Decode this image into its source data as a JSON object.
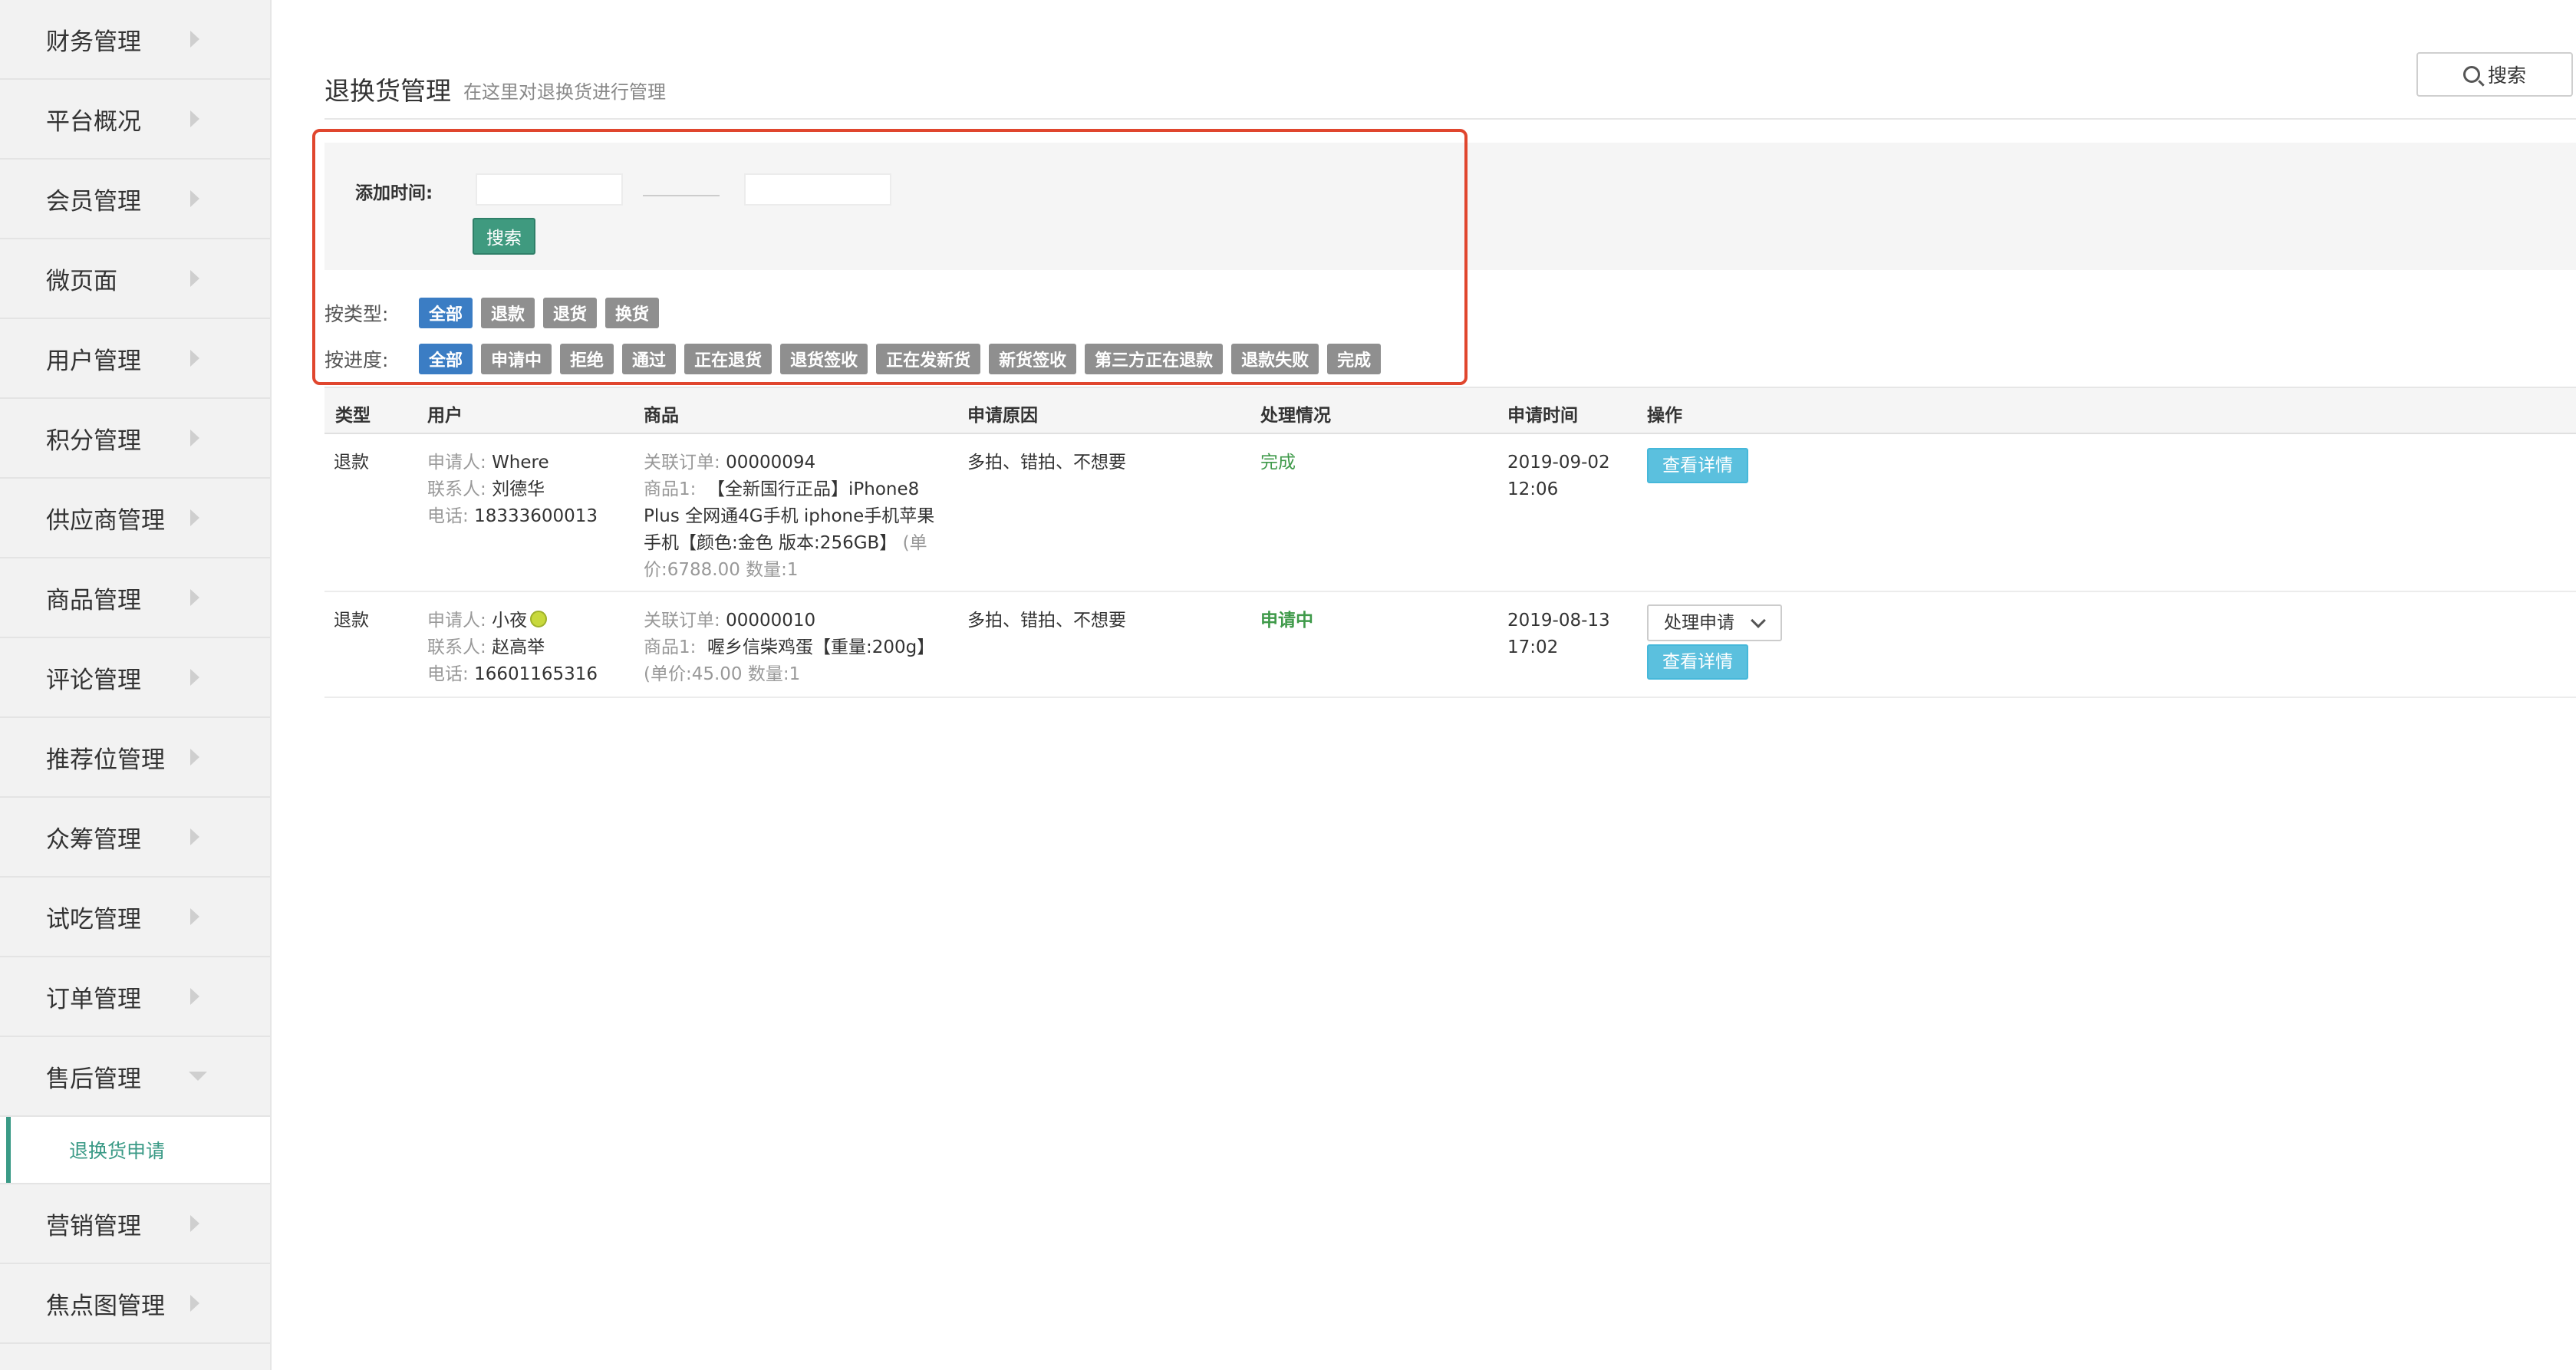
{
  "sidebar": {
    "items": [
      {
        "label": "财务管理"
      },
      {
        "label": "平台概况"
      },
      {
        "label": "会员管理"
      },
      {
        "label": "微页面"
      },
      {
        "label": "用户管理"
      },
      {
        "label": "积分管理"
      },
      {
        "label": "供应商管理"
      },
      {
        "label": "商品管理"
      },
      {
        "label": "评论管理"
      },
      {
        "label": "推荐位管理"
      },
      {
        "label": "众筹管理"
      },
      {
        "label": "试吃管理"
      },
      {
        "label": "订单管理"
      },
      {
        "label": "售后管理"
      }
    ],
    "sub_item": {
      "label": "退换货申请"
    },
    "items_after": [
      {
        "label": "营销管理"
      },
      {
        "label": "焦点图管理"
      }
    ]
  },
  "header": {
    "title": "退换货管理",
    "subtitle": "在这里对退换货进行管理",
    "search_label": "搜索"
  },
  "filters": {
    "date_label": "添加时间:",
    "search_button": "搜索",
    "type_label": "按类型:",
    "type_tags": [
      "全部",
      "退款",
      "退货",
      "换货"
    ],
    "progress_label": "按进度:",
    "progress_tags": [
      "全部",
      "申请中",
      "拒绝",
      "通过",
      "正在退货",
      "退货签收",
      "正在发新货",
      "新货签收",
      "第三方正在退款",
      "退款失败",
      "完成"
    ]
  },
  "table": {
    "headers": [
      "类型",
      "用户",
      "商品",
      "申请原因",
      "处理情况",
      "申请时间",
      "操作"
    ],
    "rows": [
      {
        "type": "退款",
        "applicant_label": "申请人:",
        "applicant": "Where",
        "contact_label": "联系人:",
        "contact": "刘德华",
        "phone_label": "电话:",
        "phone": "18333600013",
        "order_label": "关联订单:",
        "order": "00000094",
        "goods_label": "商品1:",
        "goods_line1": "【全新国行正品】iPhone8",
        "goods_line2": "Plus 全网通4G手机 iphone手机苹果",
        "goods_line3": "手机【颜色:金色 版本:256GB】",
        "goods_line3_muted": "(单",
        "price_line": "价:6788.00   数量:1",
        "reason": "多拍、错拍、不想要",
        "status": "完成",
        "time_date": "2019-09-02",
        "time_clock": "12:06",
        "detail_button": "查看详情"
      },
      {
        "type": "退款",
        "applicant_label": "申请人:",
        "applicant": "小夜",
        "contact_label": "联系人:",
        "contact": "赵高举",
        "phone_label": "电话:",
        "phone": "16601165316",
        "order_label": "关联订单:",
        "order": "00000010",
        "goods_label": "商品1:",
        "goods_line1": "喔乡信柴鸡蛋【重量:200g】",
        "price_line": "(单价:45.00   数量:1",
        "reason": "多拍、错拍、不想要",
        "status": "申请中",
        "time_date": "2019-08-13",
        "time_clock": "17:02",
        "process_button": "处理申请",
        "detail_button": "查看详情"
      }
    ]
  },
  "colors": {
    "accent": "#3f9a7f",
    "active_tag": "#3b7dc4",
    "tag": "#8f8f8f",
    "highlight": "#e0462e",
    "detail_button": "#5bc0de"
  }
}
